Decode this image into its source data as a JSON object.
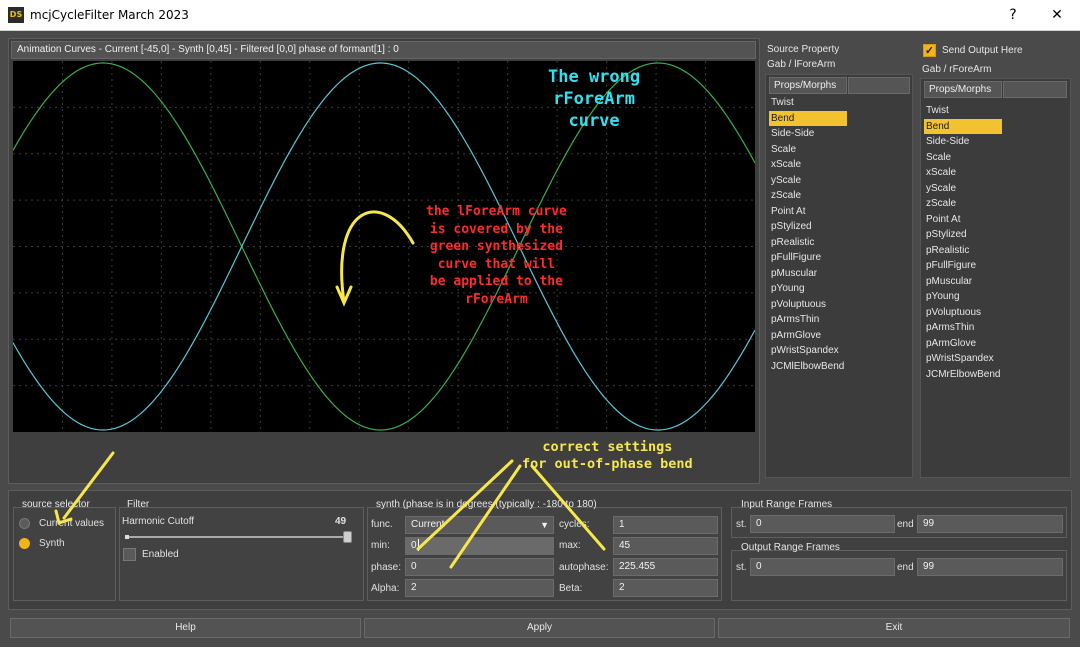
{
  "window": {
    "title": "mcjCycleFilter March 2023",
    "icon_text": "DS",
    "help_btn": "?",
    "close_btn": "✕"
  },
  "graph": {
    "header": "Animation Curves  - Current [-45,0]    - Synth [0,45]    - Filtered [0,0]     phase of formant[1] : 0",
    "colors": {
      "synth": "#3ab04a",
      "wrong": "#5ac8d8",
      "grid": "#3a3a3a"
    }
  },
  "chart_data": {
    "type": "line",
    "series": [
      {
        "color": "#3ab04a",
        "phase_deg": 0,
        "min": 0,
        "max": 45
      },
      {
        "color": "#5ac8d8",
        "phase_deg": 180,
        "min": -45,
        "max": 0
      }
    ],
    "grid": true
  },
  "annotations": {
    "wrong_curve": [
      "The wrong",
      "rForeArm",
      "curve"
    ],
    "covered": [
      "the lForeArm curve",
      "is covered by the",
      "green synthesized",
      "curve that will",
      "be applied to the",
      "rForeArm"
    ],
    "correct": [
      "correct settings",
      "for out-of-phase bend"
    ],
    "colors": {
      "cyan": "#33e0f0",
      "red": "#ff2a2a",
      "yellow": "#f6e84a"
    }
  },
  "source": {
    "label": "Source Property",
    "actor": "Gab / lForeArm",
    "tab": "Props/Morphs",
    "items": [
      "Twist",
      "Bend",
      "Side-Side",
      "Scale",
      "xScale",
      "yScale",
      "zScale",
      "Point At",
      "pStylized",
      "pRealistic",
      "pFullFigure",
      "pMuscular",
      "pYoung",
      "pVoluptuous",
      "pArmsThin",
      "pArmGlove",
      "pWristSpandex",
      "JCMlElbowBend"
    ],
    "selected": "Bend"
  },
  "output": {
    "label": "Send Output Here",
    "checked": true,
    "actor": "Gab / rForeArm",
    "tab": "Props/Morphs",
    "items": [
      "Twist",
      "Bend",
      "Side-Side",
      "Scale",
      "xScale",
      "yScale",
      "zScale",
      "Point At",
      "pStylized",
      "pRealistic",
      "pFullFigure",
      "pMuscular",
      "pYoung",
      "pVoluptuous",
      "pArmsThin",
      "pArmGlove",
      "pWristSpandex",
      "JCMrElbowBend"
    ],
    "selected": "Bend"
  },
  "source_selector": {
    "title": "source selector",
    "options": [
      {
        "label": "Current values",
        "selected": false
      },
      {
        "label": "Synth",
        "selected": true
      }
    ]
  },
  "filter": {
    "title": "Filter",
    "cutoff_label": "Harmonic Cutoff",
    "cutoff_value": "49",
    "cutoff_fraction": 1.0,
    "enabled_label": "Enabled",
    "enabled": false
  },
  "synth": {
    "title": "synth (phase is in degrees (typically : -180 to 180)",
    "func_label": "func.",
    "func_value": "Current",
    "cycles_label": "cycles:",
    "cycles_value": "1",
    "min_label": "min:",
    "min_value": "0",
    "max_label": "max:",
    "max_value": "45",
    "phase_label": "phase:",
    "phase_value": "0",
    "autophase_label": "autophase:",
    "autophase_value": "225.455",
    "alpha_label": "Alpha:",
    "alpha_value": "2",
    "beta_label": "Beta:",
    "beta_value": "2"
  },
  "input_range": {
    "title": "Input Range Frames",
    "st_label": "st.",
    "st_value": "0",
    "end_label": "end",
    "end_value": "99"
  },
  "output_range": {
    "title": "Output Range Frames",
    "st_label": "st.",
    "st_value": "0",
    "end_label": "end",
    "end_value": "99"
  },
  "buttons": {
    "help": "Help",
    "apply": "Apply",
    "exit": "Exit"
  }
}
